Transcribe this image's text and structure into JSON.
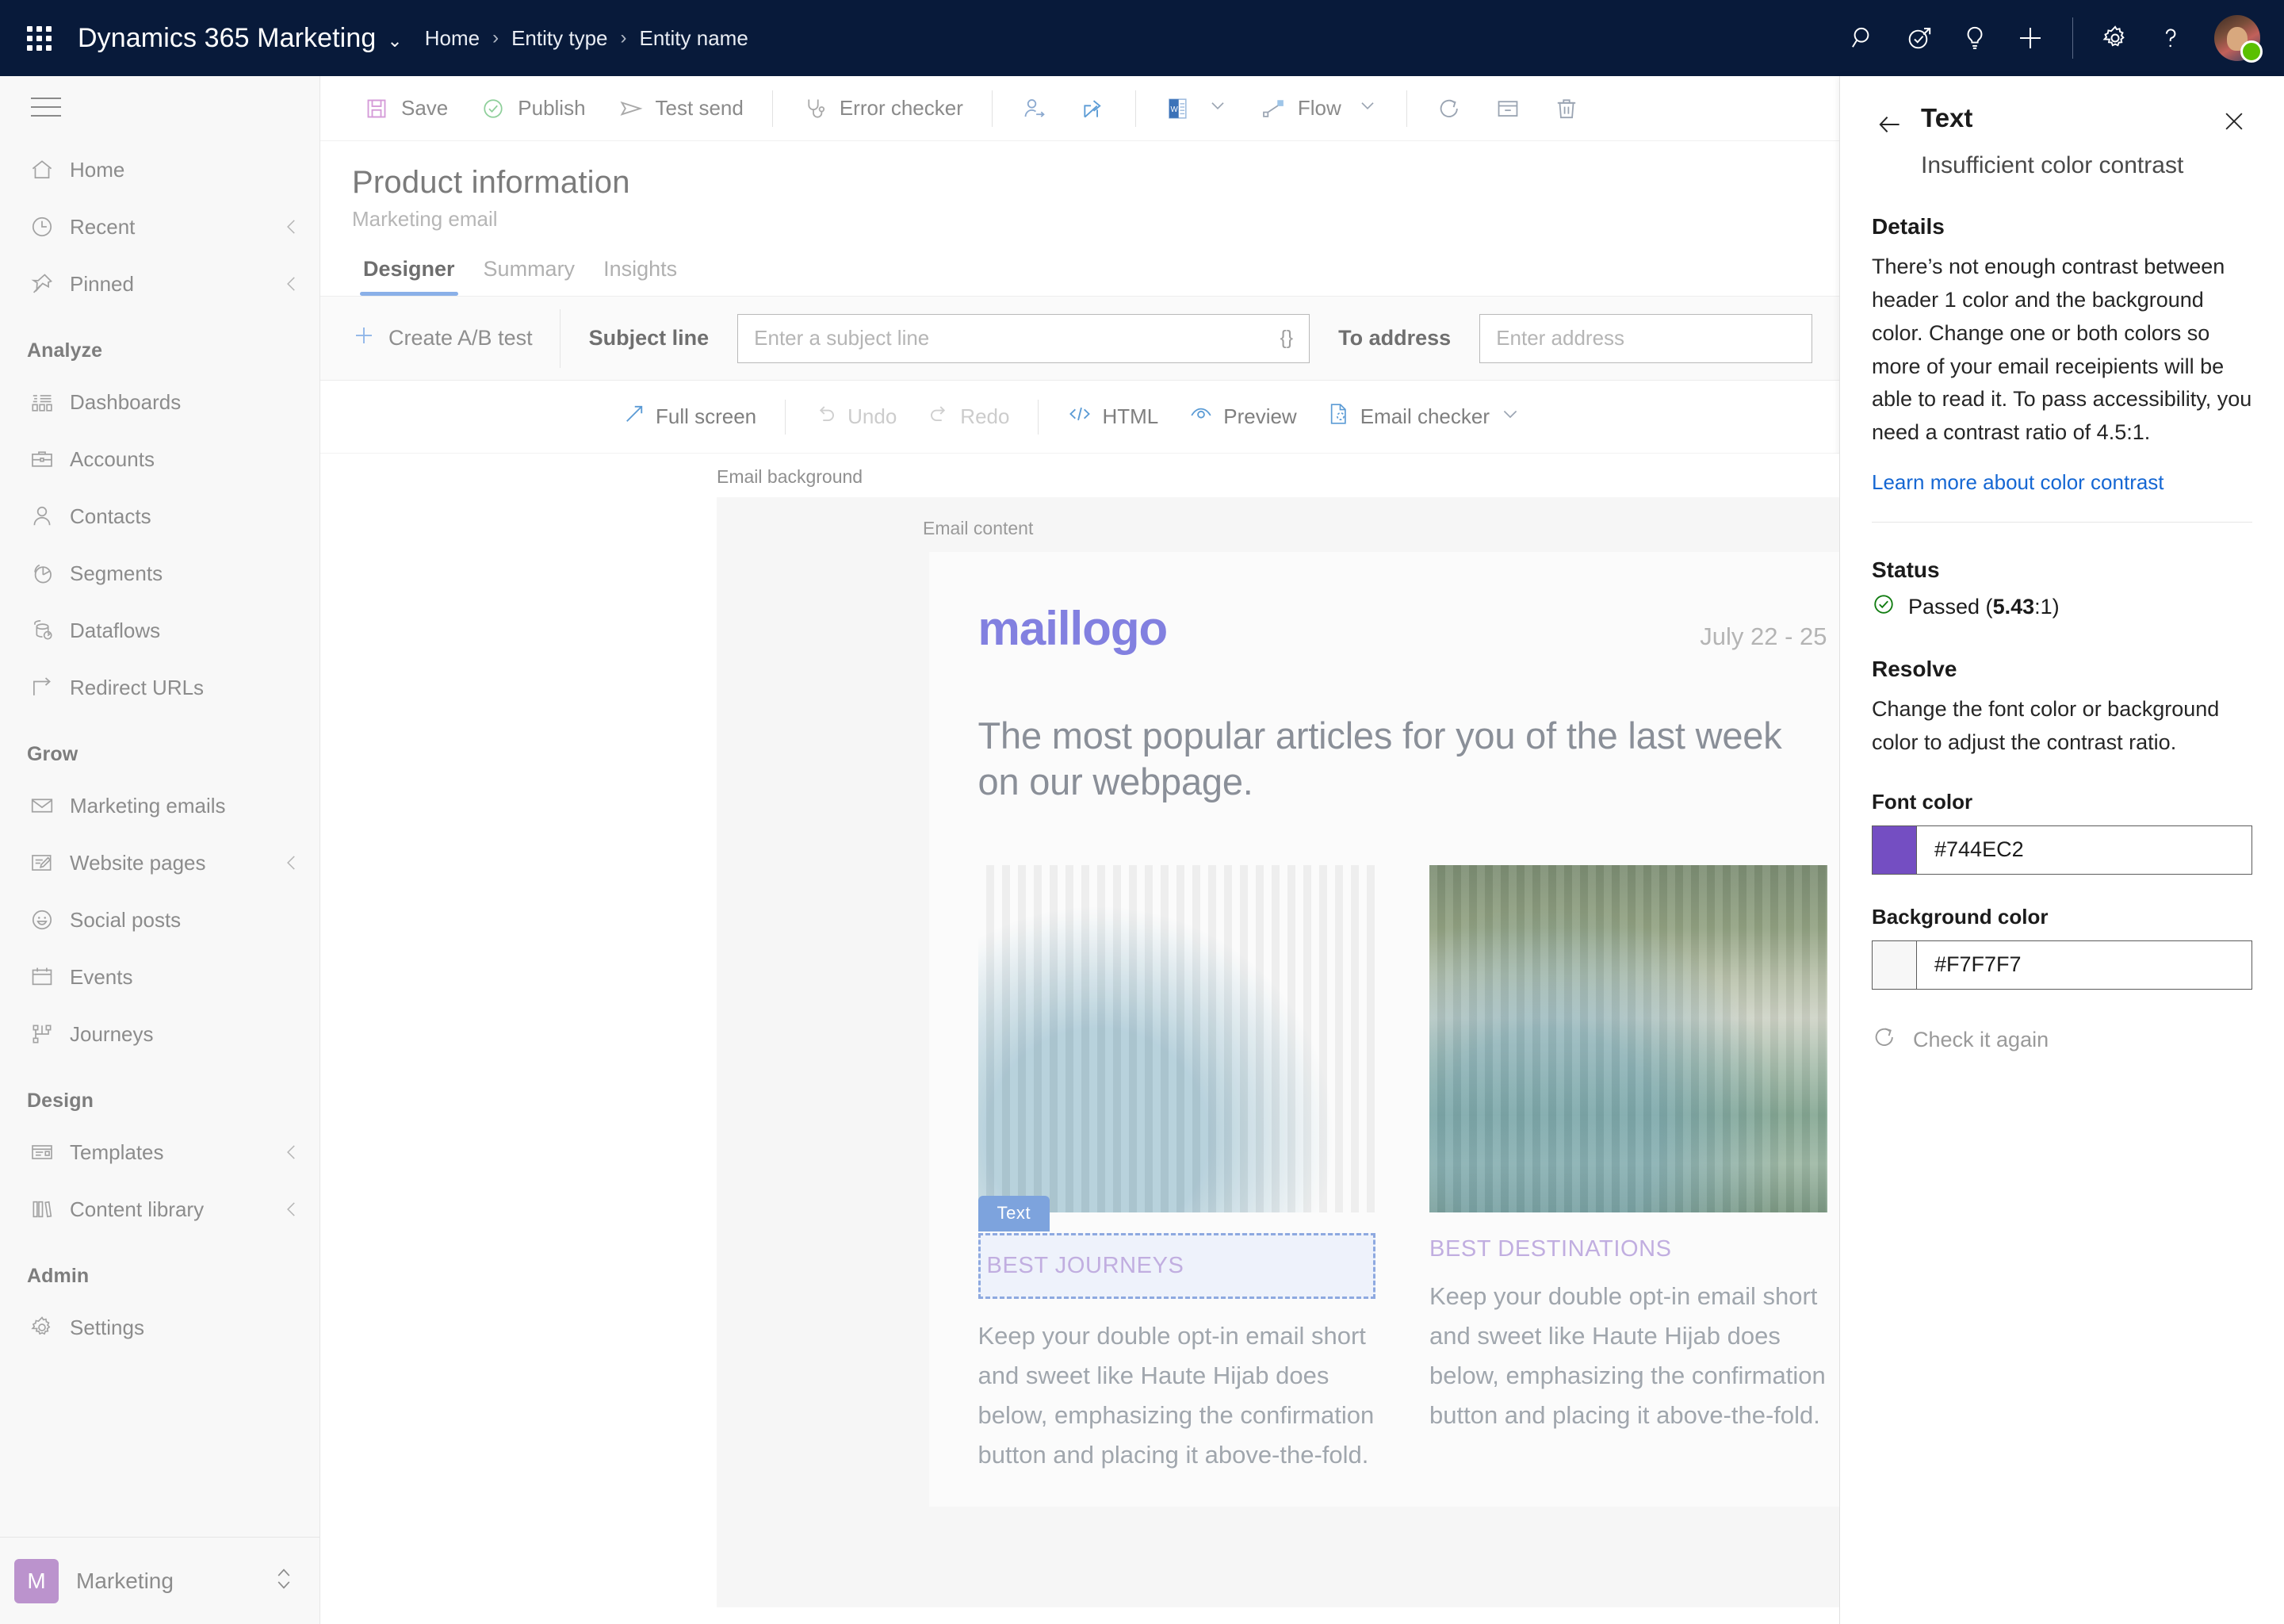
{
  "topbar": {
    "waffle_title": "App launcher",
    "brand": "Dynamics 365 Marketing",
    "brand_caret": "⌄",
    "breadcrumbs": [
      "Home",
      "Entity type",
      "Entity name"
    ],
    "separator": "›",
    "icons": [
      "search-icon",
      "assistant-icon",
      "insights-lightbulb-icon",
      "add-icon",
      "settings-gear-icon",
      "help-question-icon"
    ],
    "avatar_label": "User avatar",
    "presence": "Available"
  },
  "sidebar": {
    "hamburger_label": "Expand navigation",
    "items": [
      {
        "label": "Home",
        "icon": "home-icon",
        "chevron": false,
        "group": null
      },
      {
        "label": "Recent",
        "icon": "clock-icon",
        "chevron": true,
        "group": null
      },
      {
        "label": "Pinned",
        "icon": "pin-icon",
        "chevron": true,
        "group": null
      },
      {
        "label": "Analyze",
        "group_header": true
      },
      {
        "label": "Dashboards",
        "icon": "dashboard-icon",
        "chevron": false
      },
      {
        "label": "Accounts",
        "icon": "briefcase-icon",
        "chevron": false
      },
      {
        "label": "Contacts",
        "icon": "person-icon",
        "chevron": false
      },
      {
        "label": "Segments",
        "icon": "pie-chart-icon",
        "chevron": false
      },
      {
        "label": "Dataflows",
        "icon": "dataflow-icon",
        "chevron": false
      },
      {
        "label": "Redirect URLs",
        "icon": "redirect-arrow-icon",
        "chevron": false
      },
      {
        "label": "Grow",
        "group_header": true
      },
      {
        "label": "Marketing emails",
        "icon": "envelope-icon",
        "chevron": false
      },
      {
        "label": "Website pages",
        "icon": "page-edit-icon",
        "chevron": true
      },
      {
        "label": "Social posts",
        "icon": "smiley-icon",
        "chevron": false
      },
      {
        "label": "Events",
        "icon": "calendar-icon",
        "chevron": false
      },
      {
        "label": "Journeys",
        "icon": "journey-flow-icon",
        "chevron": false
      },
      {
        "label": "Design",
        "group_header": true
      },
      {
        "label": "Templates",
        "icon": "template-icon",
        "chevron": true
      },
      {
        "label": "Content library",
        "icon": "books-icon",
        "chevron": true
      },
      {
        "label": "Admin",
        "group_header": true
      },
      {
        "label": "Settings",
        "icon": "gear-icon",
        "chevron": false
      }
    ],
    "footer": {
      "badge": "M",
      "name": "Marketing",
      "switcher_icon": "up-down-chevrons-icon"
    }
  },
  "command_bar": {
    "items": [
      {
        "label": "Save",
        "icon": "save-floppy-icon"
      },
      {
        "label": "Publish",
        "icon": "publish-check-icon"
      },
      {
        "label": "Test send",
        "icon": "send-plane-icon"
      },
      {
        "label": "Error checker",
        "icon": "stethoscope-icon"
      }
    ],
    "icon_only": [
      {
        "name": "assign-user-icon"
      },
      {
        "name": "share-icon"
      },
      {
        "name": "word-template-icon",
        "caret": true
      },
      {
        "name": "flow-icon",
        "label": "Flow",
        "caret": true
      },
      {
        "name": "refresh-icon"
      },
      {
        "name": "archive-icon"
      },
      {
        "name": "delete-trash-icon"
      }
    ],
    "flow_label": "Flow"
  },
  "page": {
    "title": "Product information",
    "subtitle": "Marketing email",
    "tabs": [
      {
        "label": "Designer",
        "active": true
      },
      {
        "label": "Summary",
        "active": false
      },
      {
        "label": "Insights",
        "active": false
      }
    ]
  },
  "subject_bar": {
    "ab_test_label": "Create A/B test",
    "subject_label": "Subject line",
    "subject_value": "",
    "subject_placeholder": "Enter a subject line",
    "personalization_glyph": "{}",
    "to_label": "To address",
    "to_value": "",
    "to_placeholder": "Enter address"
  },
  "designer_toolbar": {
    "items": [
      {
        "label": "Full screen",
        "icon": "expand-arrow-icon",
        "disabled": false
      },
      {
        "label": "Undo",
        "icon": "undo-icon",
        "disabled": true
      },
      {
        "label": "Redo",
        "icon": "redo-icon",
        "disabled": true
      },
      {
        "label": "HTML",
        "icon": "code-brackets-icon",
        "disabled": false
      },
      {
        "label": "Preview",
        "icon": "eye-preview-icon",
        "disabled": false
      },
      {
        "label": "Email checker",
        "icon": "email-checker-icon",
        "disabled": false,
        "caret": true
      }
    ]
  },
  "canvas": {
    "background_label": "Email background",
    "content_label": "Email content",
    "email": {
      "logo": "maillogo",
      "date": "July 22 - 25",
      "headline": "The most popular articles for you of the last week on our webpage.",
      "columns": [
        {
          "image_name": "pool-resort-photo",
          "eyebrow": "BEST JOURNEYS",
          "selected": true,
          "selection_tag": "Text",
          "body": "Keep your double opt-in email short and sweet like Haute Hijab does below, emphasizing the confirmation button and placing it above-the-fold."
        },
        {
          "image_name": "tropical-plants-photo",
          "eyebrow": "BEST DESTINATIONS",
          "selected": false,
          "body": "Keep your double opt-in email short and sweet like Haute Hijab does below, emphasizing the confirmation button and placing it above-the-fold."
        }
      ]
    }
  },
  "right_panel": {
    "back_icon": "back-arrow-icon",
    "title": "Text",
    "close_icon": "close-icon",
    "subtitle": "Insufficient color contrast",
    "details_heading": "Details",
    "details_body": "There’s not enough contrast between header 1 color and the background color. Change one or both colors so more of your email receipients will be able to read it. To pass accessibility, you need a contrast ratio of 4.5:1.",
    "learn_more": "Learn more about color contrast",
    "status_heading": "Status",
    "status_icon": "check-circle-icon",
    "status_text_prefix": "Passed (",
    "status_value": "5.43",
    "status_text_suffix": ":1)",
    "resolve_heading": "Resolve",
    "resolve_body": "Change the font color or background color to adjust the contrast ratio.",
    "font_color_label": "Font color",
    "font_color_value": "#744EC2",
    "background_color_label": "Background color",
    "background_color_value": "#F7F7F7",
    "recheck_label": "Check it again",
    "recheck_icon": "refresh-circle-icon"
  },
  "colors": {
    "nav_bar": "#081A3A",
    "accent_blue": "#8AB0E8",
    "link_blue": "#1567D3",
    "status_green": "#107C10",
    "marketing_badge": "#BB93CD",
    "font_color_swatch": "#744EC2",
    "background_color_swatch": "#F7F7F7",
    "logo_purple": "#8280E0",
    "eyebrow_purple": "#C1AEE0"
  }
}
